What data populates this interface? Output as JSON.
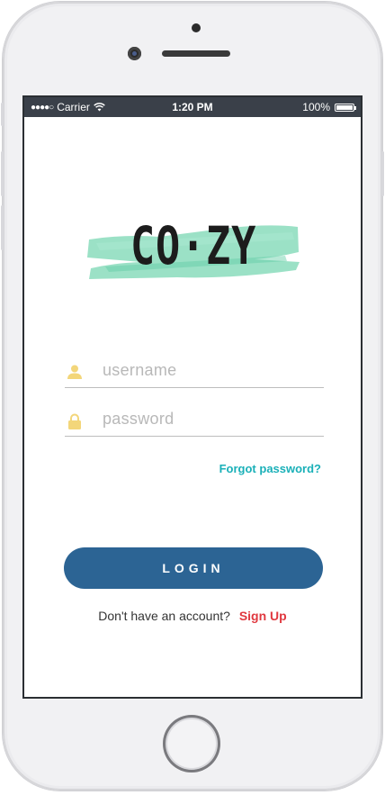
{
  "status_bar": {
    "signal_dots": "●●●●○",
    "carrier": "Carrier",
    "time": "1:20 PM",
    "battery": "100%"
  },
  "brand": {
    "logo_text": "CO·ZY",
    "accent_color": "#7fd9b6"
  },
  "login_form": {
    "username_placeholder": "username",
    "password_placeholder": "password",
    "forgot_password_label": "Forgot password?",
    "login_button_label": "LOGIN",
    "no_account_text": "Don't have an account?",
    "signup_label": "Sign Up"
  },
  "colors": {
    "primary_button": "#2c6494",
    "link_teal": "#1ab0b8",
    "signup_red": "#e0383f",
    "icon_yellow": "#f3d67a"
  }
}
